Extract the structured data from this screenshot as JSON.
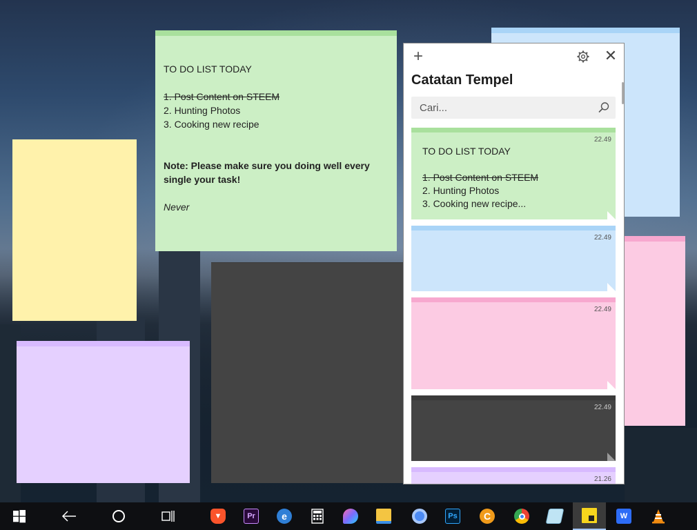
{
  "desktop_notes": {
    "green_note": {
      "title": "TO DO LIST TODAY",
      "items": [
        "1. Post Content on STEEM",
        "2. Hunting Photos",
        "3. Cooking new recipe"
      ],
      "note_line": "Note: Please make sure you doing well every single your task!",
      "closing": "Never"
    }
  },
  "panel": {
    "title": "Catatan Tempel",
    "search_placeholder": "Cari...",
    "cards": [
      {
        "time": "22.49",
        "title": "TO DO LIST TODAY",
        "line1": "1. Post Content on STEEM",
        "line2": "2. Hunting Photos",
        "line3": "3. Cooking new recipe..."
      },
      {
        "time": "22.49"
      },
      {
        "time": "22.49"
      },
      {
        "time": "22.49"
      },
      {
        "time": "21.26"
      }
    ]
  },
  "colors": {
    "green": "#ccefc5",
    "green_top": "#a9e09d",
    "blue": "#cce5fb",
    "blue_top": "#a9d4f7",
    "pink": "#fccbe3",
    "pink_top": "#f7a8cf",
    "yellow": "#fff2ab",
    "yellow_top": "#fff2ab",
    "purple": "#e5d0ff",
    "purple_top": "#d8baff",
    "charcoal": "#444444",
    "charcoal_top": "#3a3a3a"
  },
  "taskbar": {
    "icons": [
      "windows-start-icon",
      "back-arrow-icon",
      "cortana-circle-icon",
      "task-view-icon",
      "brave-browser-icon",
      "premiere-pro-icon",
      "edge-icon",
      "calculator-icon",
      "paint-3d-icon",
      "file-explorer-icon",
      "chromium-icon",
      "photoshop-icon",
      "c-app-icon",
      "chrome-icon",
      "notepad-icon",
      "sticky-notes-icon",
      "wps-office-icon",
      "vlc-icon"
    ],
    "premiere_label": "Pr",
    "photoshop_label": "Ps",
    "c_label": "C",
    "wps_label": "W"
  }
}
